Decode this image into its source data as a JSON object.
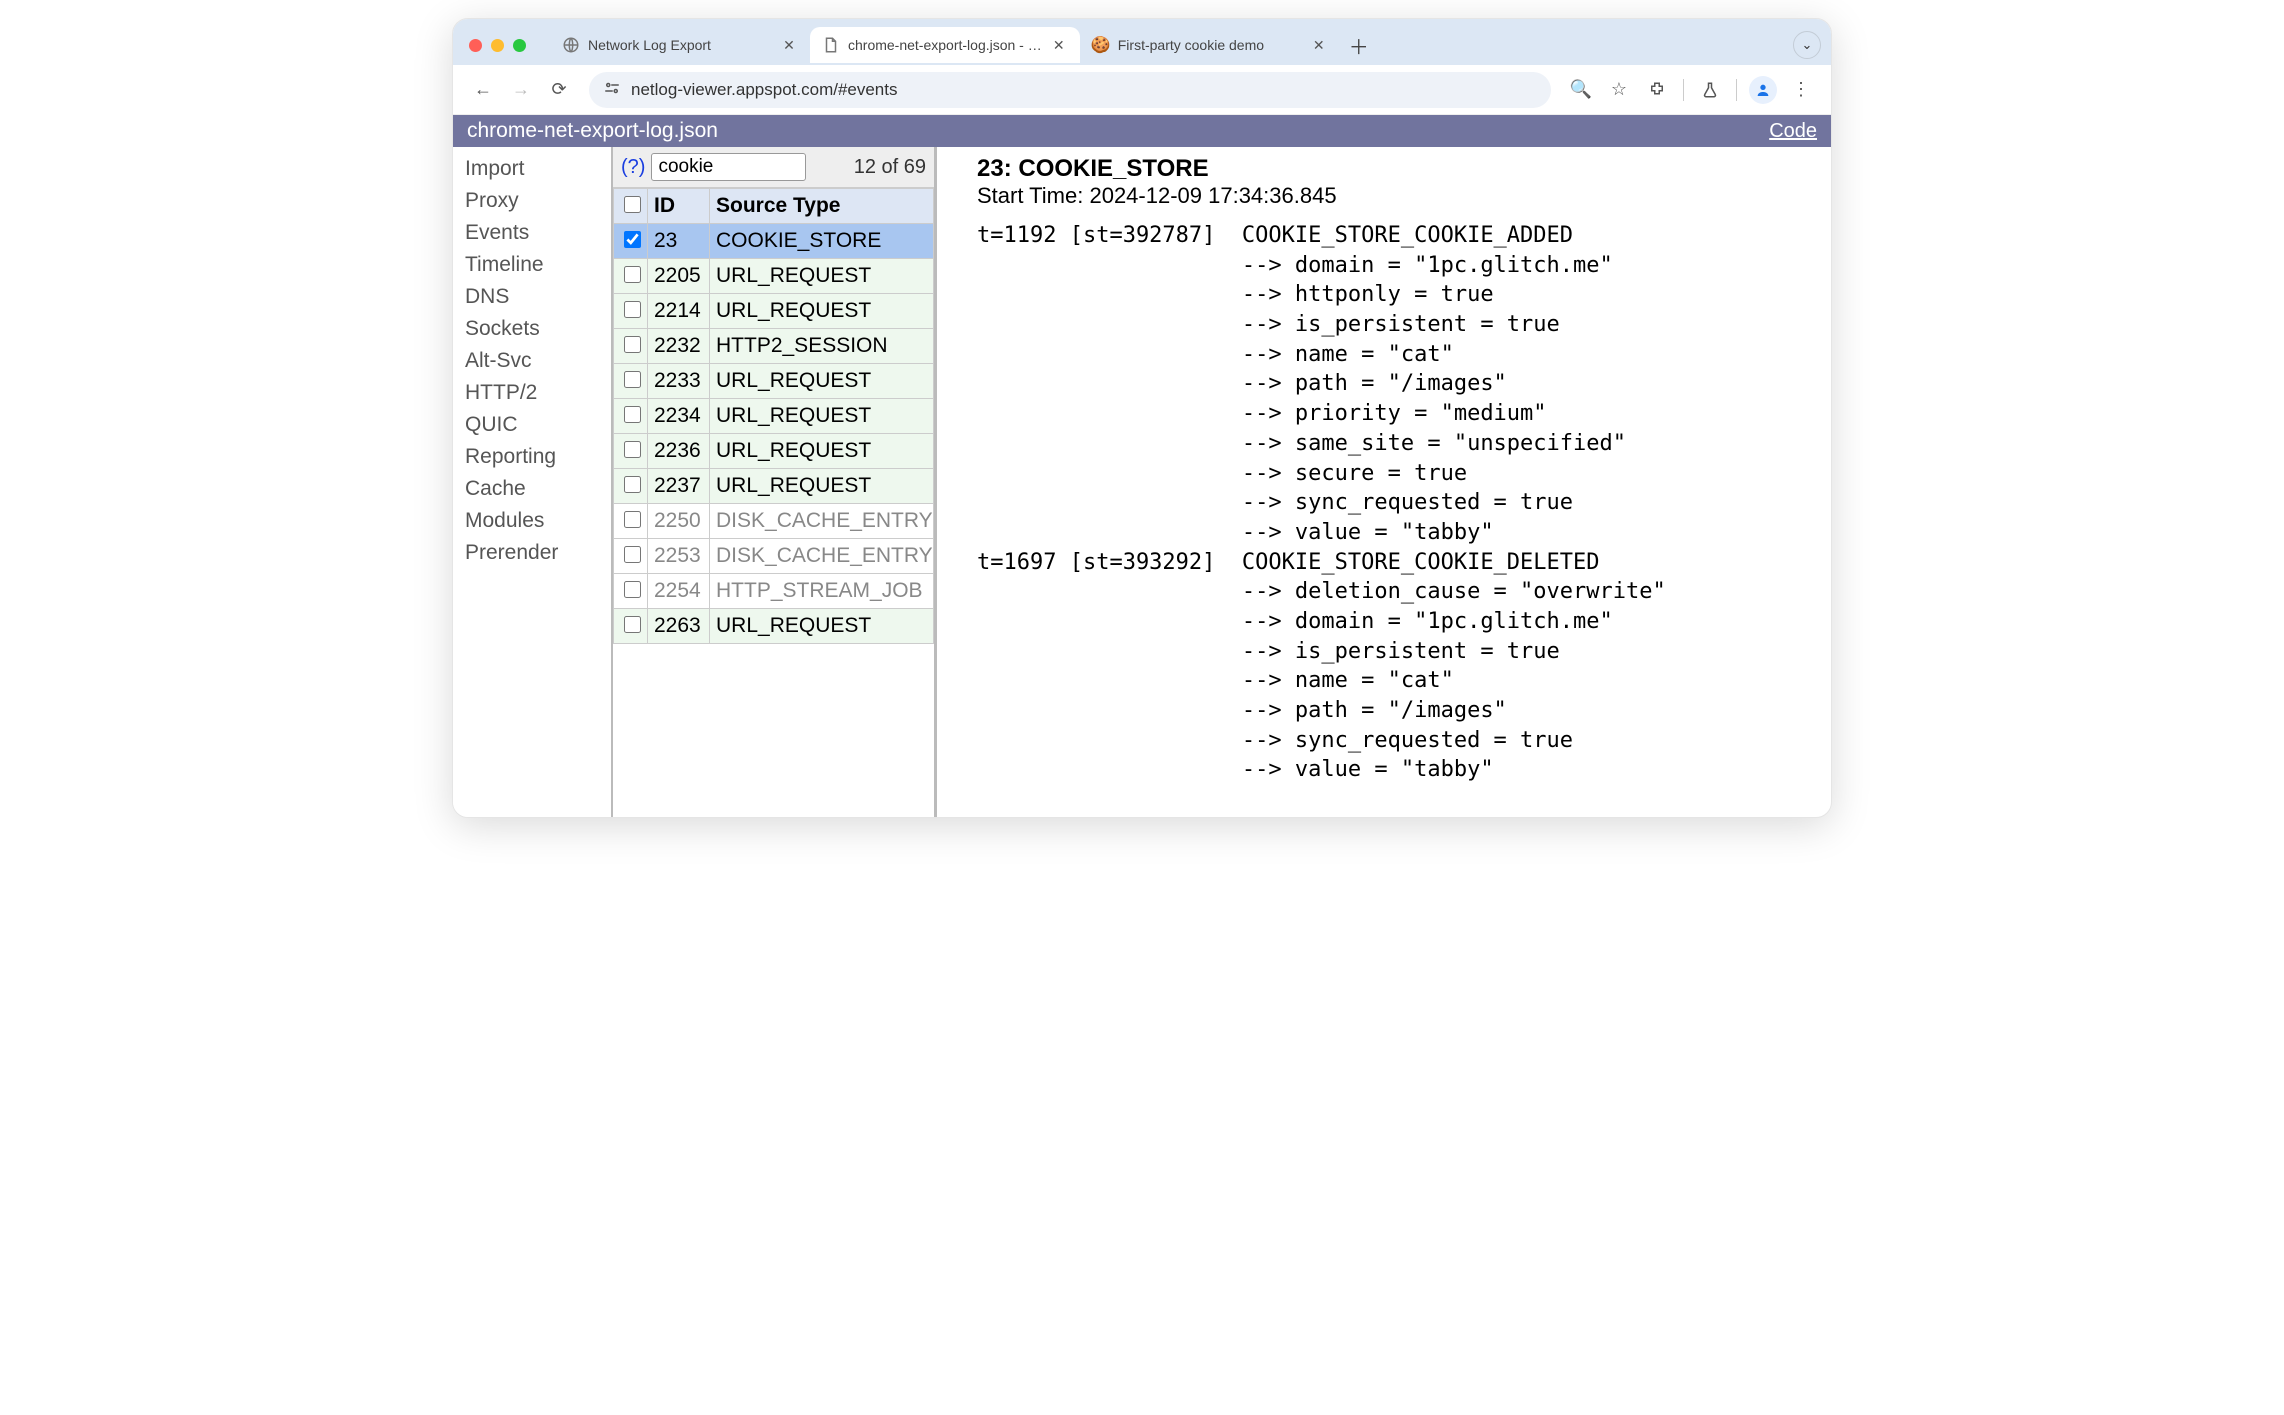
{
  "tabs": [
    {
      "title": "Network Log Export",
      "favicon": "globe"
    },
    {
      "title": "chrome-net-export-log.json - …",
      "favicon": "doc",
      "active": true
    },
    {
      "title": "First-party cookie demo",
      "favicon": "cookie"
    }
  ],
  "url": "netlog-viewer.appspot.com/#events",
  "app_title": "chrome-net-export-log.json",
  "code_label": "Code",
  "sidebar": [
    "Import",
    "Proxy",
    "Events",
    "Timeline",
    "DNS",
    "Sockets",
    "Alt-Svc",
    "HTTP/2",
    "QUIC",
    "Reporting",
    "Cache",
    "Modules",
    "Prerender"
  ],
  "filter": {
    "help": "(?)",
    "value": "cookie",
    "count": "12 of 69"
  },
  "columns": {
    "id": "ID",
    "source": "Source Type"
  },
  "rows": [
    {
      "id": "23",
      "type": "COOKIE_STORE",
      "selected": true,
      "variant": "selected"
    },
    {
      "id": "2205",
      "type": "URL_REQUEST",
      "variant": "alt"
    },
    {
      "id": "2214",
      "type": "URL_REQUEST",
      "variant": "alt"
    },
    {
      "id": "2232",
      "type": "HTTP2_SESSION",
      "variant": "alt"
    },
    {
      "id": "2233",
      "type": "URL_REQUEST",
      "variant": "alt"
    },
    {
      "id": "2234",
      "type": "URL_REQUEST",
      "variant": "alt"
    },
    {
      "id": "2236",
      "type": "URL_REQUEST",
      "variant": "alt"
    },
    {
      "id": "2237",
      "type": "URL_REQUEST",
      "variant": "alt"
    },
    {
      "id": "2250",
      "type": "DISK_CACHE_ENTRY",
      "variant": "gray"
    },
    {
      "id": "2253",
      "type": "DISK_CACHE_ENTRY",
      "variant": "gray"
    },
    {
      "id": "2254",
      "type": "HTTP_STREAM_JOB",
      "variant": "gray"
    },
    {
      "id": "2263",
      "type": "URL_REQUEST",
      "variant": "alt"
    }
  ],
  "detail": {
    "title": "23: COOKIE_STORE",
    "start": "Start Time: 2024-12-09 17:34:36.845",
    "log": "t=1192 [st=392787]  COOKIE_STORE_COOKIE_ADDED\n                    --> domain = \"1pc.glitch.me\"\n                    --> httponly = true\n                    --> is_persistent = true\n                    --> name = \"cat\"\n                    --> path = \"/images\"\n                    --> priority = \"medium\"\n                    --> same_site = \"unspecified\"\n                    --> secure = true\n                    --> sync_requested = true\n                    --> value = \"tabby\"\nt=1697 [st=393292]  COOKIE_STORE_COOKIE_DELETED\n                    --> deletion_cause = \"overwrite\"\n                    --> domain = \"1pc.glitch.me\"\n                    --> is_persistent = true\n                    --> name = \"cat\"\n                    --> path = \"/images\"\n                    --> sync_requested = true\n                    --> value = \"tabby\""
  }
}
